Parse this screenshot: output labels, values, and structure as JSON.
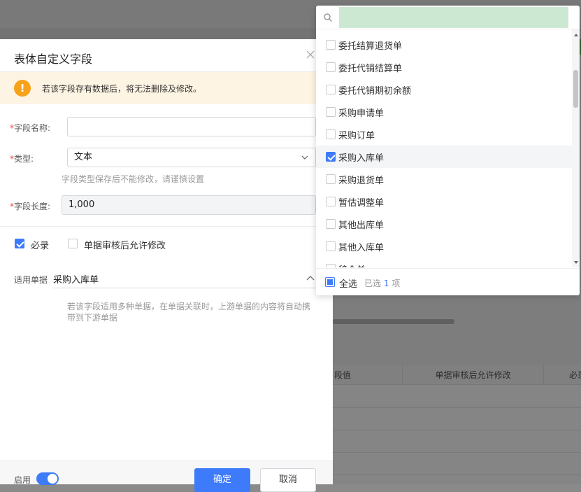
{
  "background": {
    "table_headers": [
      "段值",
      "单据审核后允许修改",
      "必录"
    ]
  },
  "drawer": {
    "title": "表体自定义字段",
    "alert_text": "若该字段存有数据后，将无法删除及修改。",
    "field_name": {
      "label": "字段名称:",
      "value": ""
    },
    "type": {
      "label": "类型:",
      "value": "文本",
      "hint": "字段类型保存后不能修改，请谨慎设置"
    },
    "field_length": {
      "label": "字段长度:",
      "value": "1,000"
    },
    "required": {
      "label": "必录",
      "checked": true
    },
    "allow_edit_after_audit": {
      "label": "单据审核后允许修改",
      "checked": false
    },
    "applicable_docs": {
      "label": "适用单据",
      "value": "采购入库单",
      "hint": "若该字段适用多种单据，在单据关联时，上游单据的内容将自动携带到下游单据"
    },
    "footer": {
      "enable_label": "启用",
      "enabled": true,
      "confirm_label": "确定",
      "cancel_label": "取消"
    }
  },
  "dropdown": {
    "search_value": "",
    "items": [
      {
        "label": "委托结算退货单",
        "checked": false
      },
      {
        "label": "委托代销结算单",
        "checked": false
      },
      {
        "label": "委托代销期初余额",
        "checked": false
      },
      {
        "label": "采购申请单",
        "checked": false
      },
      {
        "label": "采购订单",
        "checked": false
      },
      {
        "label": "采购入库单",
        "checked": true
      },
      {
        "label": "采购退货单",
        "checked": false
      },
      {
        "label": "暂估调整单",
        "checked": false
      },
      {
        "label": "其他出库单",
        "checked": false
      },
      {
        "label": "其他入库单",
        "checked": false
      },
      {
        "label": "移仓单",
        "checked": false
      }
    ],
    "select_all_label": "全选",
    "selected_prefix": "已选",
    "selected_count": "1",
    "selected_suffix": "项"
  },
  "colors": {
    "primary": "#3e7bfa",
    "warning": "#f7a21b",
    "required": "#e8483e",
    "search_highlight": "#cde8d2"
  }
}
